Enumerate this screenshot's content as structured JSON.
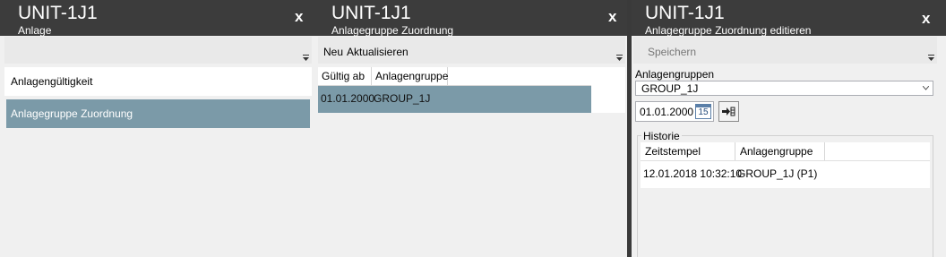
{
  "panel1": {
    "title": "UNIT-1J1",
    "subtitle": "Anlage",
    "close": "x",
    "items": [
      {
        "label": "Anlagengültigkeit"
      },
      {
        "label": "Anlagegruppe Zuordnung"
      }
    ]
  },
  "panel2": {
    "title": "UNIT-1J1",
    "subtitle": "Anlagegruppe Zuordnung",
    "close": "x",
    "toolbar": {
      "new_label": "Neu",
      "refresh_label": "Aktualisieren"
    },
    "columns": [
      "Gültig ab",
      "Anlagengruppe"
    ],
    "rows": [
      {
        "valid_from": "01.01.2000",
        "group": "GROUP_1J"
      }
    ]
  },
  "panel3": {
    "title": "UNIT-1J1",
    "subtitle": "Anlagegruppe Zuordnung editieren",
    "close": "x",
    "toolbar": {
      "save_label": "Speichern"
    },
    "group_label": "Anlagengruppen",
    "group_value": "GROUP_1J",
    "date_value": "01.01.2000",
    "calendar_day": "15",
    "history": {
      "legend": "Historie",
      "columns": [
        "Zeitstempel",
        "Anlagengruppe"
      ],
      "rows": [
        {
          "timestamp": "12.01.2018 10:32:10",
          "group": "GROUP_1J (P1)"
        }
      ]
    }
  },
  "colors": {
    "header_bg": "#3c3c3c",
    "selection": "#7b9aa8",
    "panel_bg": "#f0f0f0",
    "separator": "#3a3a3a"
  }
}
